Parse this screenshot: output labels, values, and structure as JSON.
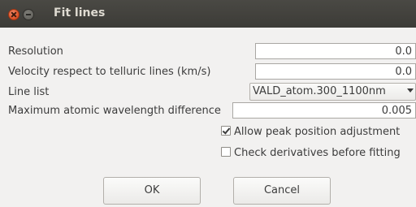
{
  "window": {
    "title": "Fit lines"
  },
  "fields": {
    "resolution": {
      "label": "Resolution",
      "value": "0.0"
    },
    "velocity": {
      "label": "Velocity respect to telluric lines (km/s)",
      "value": "0.0"
    },
    "line_list": {
      "label": "Line list",
      "value": "VALD_atom.300_1100nm"
    },
    "max_diff": {
      "label": "Maximum atomic wavelength difference",
      "value": "0.005"
    }
  },
  "options": {
    "allow_peak": {
      "label": "Allow peak position adjustment",
      "checked": true
    },
    "check_derivatives": {
      "label": "Check derivatives before fitting",
      "checked": false
    }
  },
  "buttons": {
    "ok": "OK",
    "cancel": "Cancel"
  }
}
